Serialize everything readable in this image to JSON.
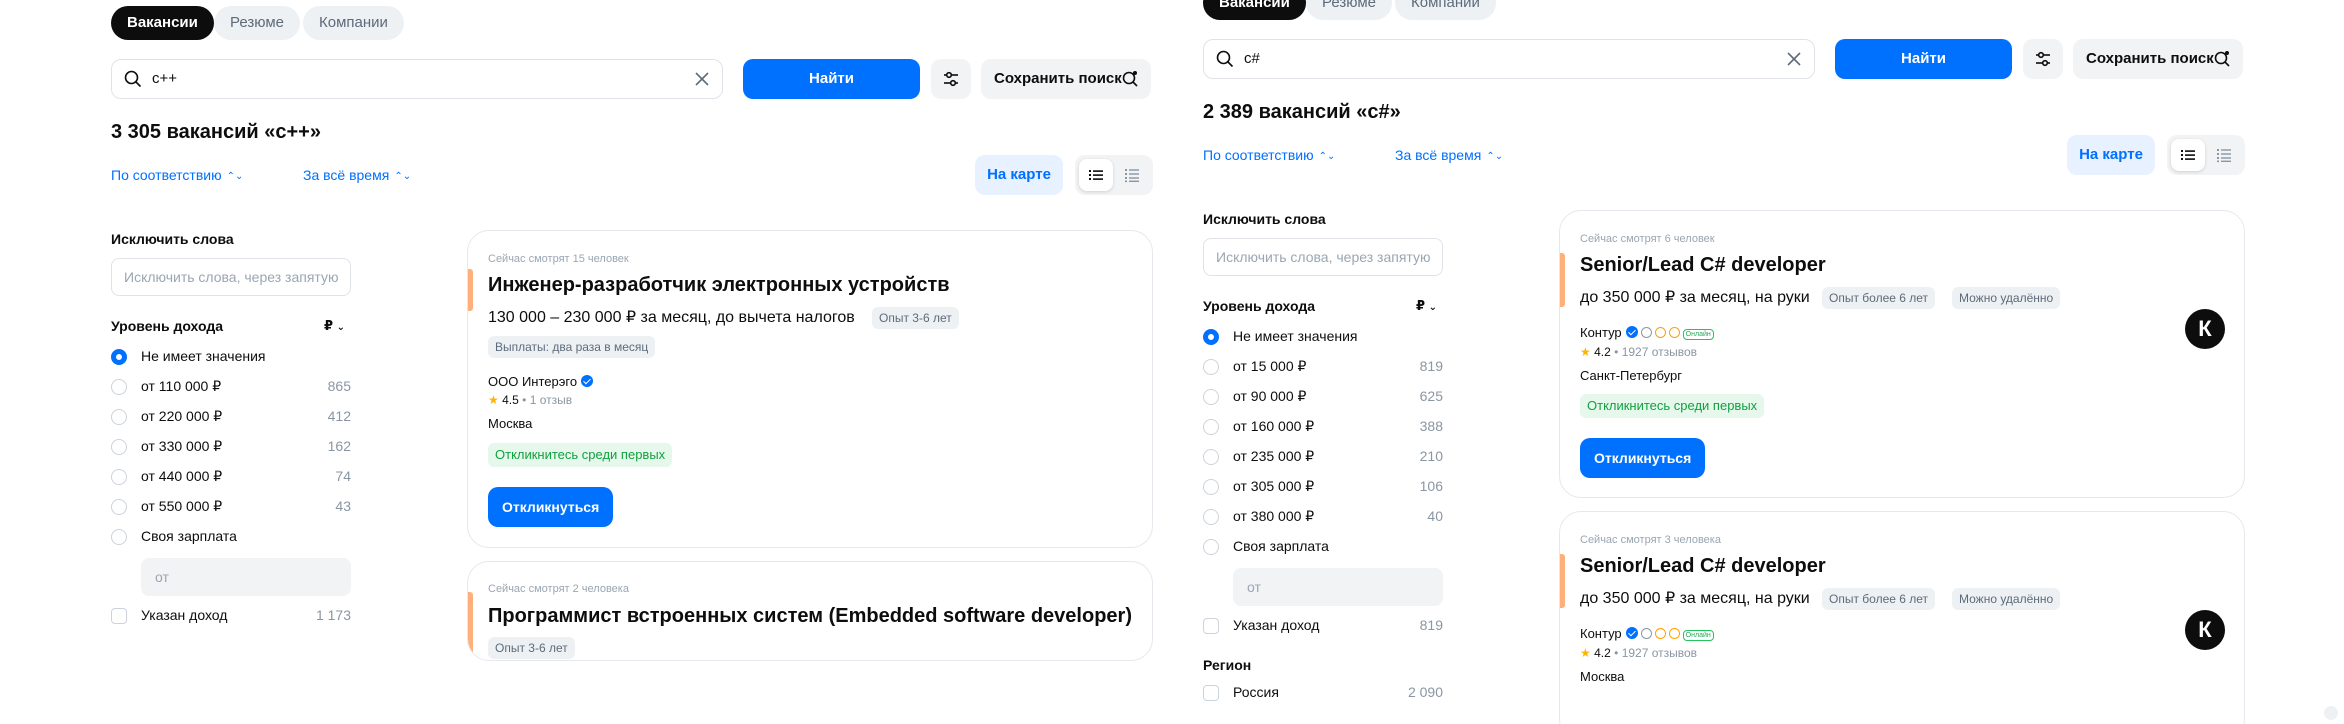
{
  "colors": {
    "accent_blue": "#0070ff",
    "text": "#0d0d0d",
    "muted": "#8a96a3",
    "card_accent": "#ffb07a",
    "success": "#12a140"
  },
  "tabs": [
    "Вакансии",
    "Резюме",
    "Компании"
  ],
  "left": {
    "search": {
      "value": "c++"
    },
    "find_label": "Найти",
    "save_search_label": "Сохранить поиск",
    "count_title": "3 305 вакансий «c++»",
    "sort_relevance": "По соответствию",
    "sort_time": "За всё время",
    "map_label": "На карте",
    "exclude": {
      "title": "Исключить слова",
      "placeholder": "Исключить слова, через запятую"
    },
    "income": {
      "title": "Уровень дохода",
      "currency": "₽",
      "options": [
        {
          "label": "Не имеет значения",
          "count": ""
        },
        {
          "label": "от 110 000 ₽",
          "count": "865"
        },
        {
          "label": "от 220 000 ₽",
          "count": "412"
        },
        {
          "label": "от 330 000 ₽",
          "count": "162"
        },
        {
          "label": "от 440 000 ₽",
          "count": "74"
        },
        {
          "label": "от 550 000 ₽",
          "count": "43"
        },
        {
          "label": "Своя зарплата",
          "count": ""
        }
      ],
      "own_placeholder": "от",
      "specified": {
        "label": "Указан доход",
        "count": "1 173"
      }
    },
    "cards": [
      {
        "viewers": "Сейчас смотрят 15 человек",
        "title": "Инженер-разработчик электронных устройств",
        "salary": "130 000 – 230 000 ₽ за месяц, до вычета налогов",
        "experience": "Опыт 3-6 лет",
        "payouts": "Выплаты: два раза в месяц",
        "company": "ООО Интерэго",
        "rating": "4.5",
        "reviews": "1 отзыв",
        "city": "Москва",
        "early": "Откликнитесь среди первых",
        "respond": "Откликнуться"
      },
      {
        "viewers": "Сейчас смотрят 2 человека",
        "title": "Программист встроенных систем (Embedded software developer)",
        "experience": "Опыт 3-6 лет"
      }
    ]
  },
  "right": {
    "search": {
      "value": "c#"
    },
    "find_label": "Найти",
    "save_search_label": "Сохранить поиск",
    "count_title": "2 389 вакансий «c#»",
    "sort_relevance": "По соответствию",
    "sort_time": "За всё время",
    "map_label": "На карте",
    "exclude": {
      "title": "Исключить слова",
      "placeholder": "Исключить слова, через запятую"
    },
    "income": {
      "title": "Уровень дохода",
      "currency": "₽",
      "options": [
        {
          "label": "Не имеет значения",
          "count": ""
        },
        {
          "label": "от 15 000 ₽",
          "count": "819"
        },
        {
          "label": "от 90 000 ₽",
          "count": "625"
        },
        {
          "label": "от 160 000 ₽",
          "count": "388"
        },
        {
          "label": "от 235 000 ₽",
          "count": "210"
        },
        {
          "label": "от 305 000 ₽",
          "count": "106"
        },
        {
          "label": "от 380 000 ₽",
          "count": "40"
        },
        {
          "label": "Своя зарплата",
          "count": ""
        }
      ],
      "own_placeholder": "от",
      "specified": {
        "label": "Указан доход",
        "count": "819"
      }
    },
    "region": {
      "title": "Регион",
      "options": [
        {
          "label": "Россия",
          "count": "2 090"
        }
      ]
    },
    "cards": [
      {
        "viewers": "Сейчас смотрят 6 человек",
        "title": "Senior/Lead C# developer",
        "salary": "до 350 000 ₽ за месяц, на руки",
        "experience": "Опыт более 6 лет",
        "remote": "Можно удалённо",
        "company": "Контур",
        "online": "Онлайн",
        "rating": "4.2",
        "reviews": "1927 отзывов",
        "city": "Санкт-Петербург",
        "early": "Откликнитесь среди первых",
        "respond": "Откликнуться",
        "logo": "К"
      },
      {
        "viewers": "Сейчас смотрят 3 человека",
        "title": "Senior/Lead C# developer",
        "salary": "до 350 000 ₽ за месяц, на руки",
        "experience": "Опыт более 6 лет",
        "remote": "Можно удалённо",
        "company": "Контур",
        "online": "Онлайн",
        "rating": "4.2",
        "reviews": "1927 отзывов",
        "city": "Москва",
        "logo": "К"
      }
    ]
  }
}
